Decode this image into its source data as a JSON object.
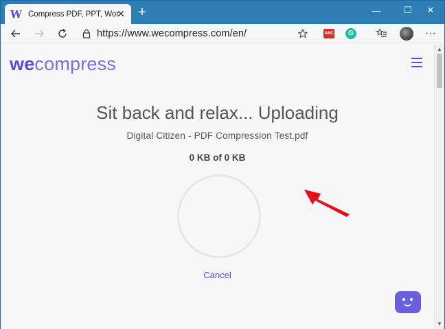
{
  "browser": {
    "tab_title": "Compress PDF, PPT, Word, Excel",
    "tab_favicon_letter": "W",
    "url": "https://www.wecompress.com/en/",
    "accent": "#2f7db5"
  },
  "site": {
    "logo_bold": "we",
    "logo_rest": "compress",
    "brand_color": "#5b4ad6"
  },
  "upload": {
    "headline": "Sit back and relax... Uploading",
    "filename": "Digital Citizen - PDF Compression Test.pdf",
    "progress_text": "0 KB of 0 KB",
    "cancel_label": "Cancel"
  },
  "icons": {
    "back": "back-arrow-icon",
    "forward": "forward-arrow-icon",
    "refresh": "refresh-icon",
    "lock": "lock-icon",
    "favorite": "star-icon",
    "favorites_bar": "favorites-icon",
    "more": "more-icon",
    "menu": "hamburger-icon",
    "chat": "chat-bot-icon",
    "annotation": "red-arrow-icon"
  }
}
